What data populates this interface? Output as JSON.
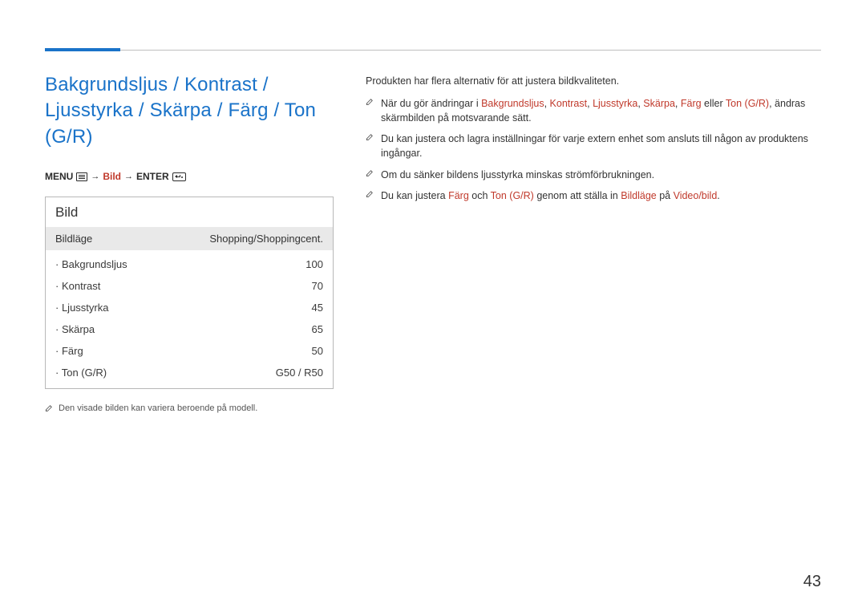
{
  "title_lines": {
    "l1": "Bakgrundsljus / Kontrast /",
    "l2": "Ljusstyrka / Skärpa / Färg / Ton (G/R)"
  },
  "breadcrumb": {
    "menu": "MENU",
    "bild": "Bild",
    "enter": "ENTER"
  },
  "panel": {
    "header": "Bild",
    "mode_label": "Bildläge",
    "mode_value": "Shopping/Shoppingcent.",
    "rows": [
      {
        "label": "Bakgrundsljus",
        "value": "100"
      },
      {
        "label": "Kontrast",
        "value": "70"
      },
      {
        "label": "Ljusstyrka",
        "value": "45"
      },
      {
        "label": "Skärpa",
        "value": "65"
      },
      {
        "label": "Färg",
        "value": "50"
      },
      {
        "label": "Ton (G/R)",
        "value": "G50 / R50"
      }
    ]
  },
  "footnote": "Den visade bilden kan variera beroende på modell.",
  "intro": "Produkten har flera alternativ för att justera bildkvaliteten.",
  "notes": {
    "n1": {
      "pre": "När du gör ändringar i ",
      "t1": "Bakgrundsljus",
      "c1": ", ",
      "t2": "Kontrast",
      "c2": ", ",
      "t3": "Ljusstyrka",
      "c3": ", ",
      "t4": "Skärpa",
      "c4": ", ",
      "t5": "Färg",
      "mid": " eller ",
      "t6": "Ton (G/R)",
      "post": ", ändras skärmbilden på motsvarande sätt."
    },
    "n2": "Du kan justera och lagra inställningar för varje extern enhet som ansluts till någon av produktens ingångar.",
    "n3": "Om du sänker bildens ljusstyrka minskas strömförbrukningen.",
    "n4": {
      "pre": "Du kan justera ",
      "t1": "Färg",
      "mid1": " och ",
      "t2": "Ton (G/R)",
      "mid2": " genom att ställa in ",
      "t3": "Bildläge",
      "mid3": " på ",
      "t4": "Video/bild",
      "post": "."
    }
  },
  "page_number": "43"
}
